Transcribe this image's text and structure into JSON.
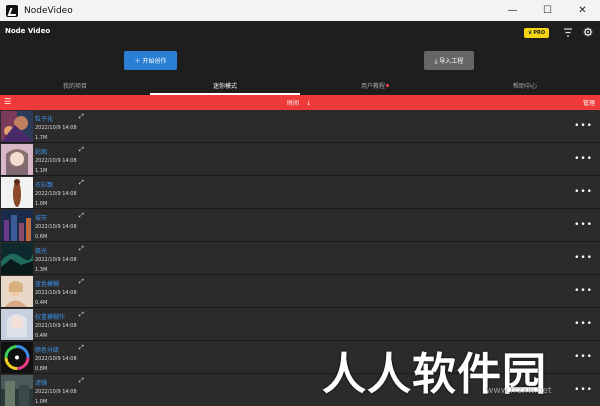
{
  "window": {
    "title": "NodeVideo",
    "minimize": "—",
    "maximize": "☐",
    "close": "✕"
  },
  "header": {
    "brand": "Node Video",
    "pro_badge": "PRO"
  },
  "actions": {
    "create_label": "＋ 开始创作",
    "import_label": "⤓ 导入工程"
  },
  "tabs": [
    {
      "label": "我的项目"
    },
    {
      "label": "迷你模式"
    },
    {
      "label": "用户教程"
    },
    {
      "label": "帮助中心"
    }
  ],
  "sortbar": {
    "label": "时间",
    "arrow": "↓",
    "manage": "管理"
  },
  "projects": [
    {
      "name": "粒子化",
      "date": "2022/10/9 14:08",
      "size": "1.7M"
    },
    {
      "name": "彩图",
      "date": "2022/10/9 14:08",
      "size": "1.1M"
    },
    {
      "name": "衣衫飘",
      "date": "2022/10/9 14:08",
      "size": "1.0M"
    },
    {
      "name": "城市",
      "date": "2022/10/9 14:08",
      "size": "0.6M"
    },
    {
      "name": "极光",
      "date": "2022/10/9 14:08",
      "size": "1.3M"
    },
    {
      "name": "蓝色模糊",
      "date": "2022/10/9 14:08",
      "size": "0.4M"
    },
    {
      "name": "权重模糊作",
      "date": "2022/10/9 14:08",
      "size": "0.4M"
    },
    {
      "name": "颜色分级",
      "date": "2022/10/9 14:08",
      "size": "0.8M"
    },
    {
      "name": "滤镜",
      "date": "2022/10/9 14:08",
      "size": "1.0M"
    }
  ],
  "watermark": {
    "main": "人人软件园",
    "url": "www.rrzxw.net"
  }
}
